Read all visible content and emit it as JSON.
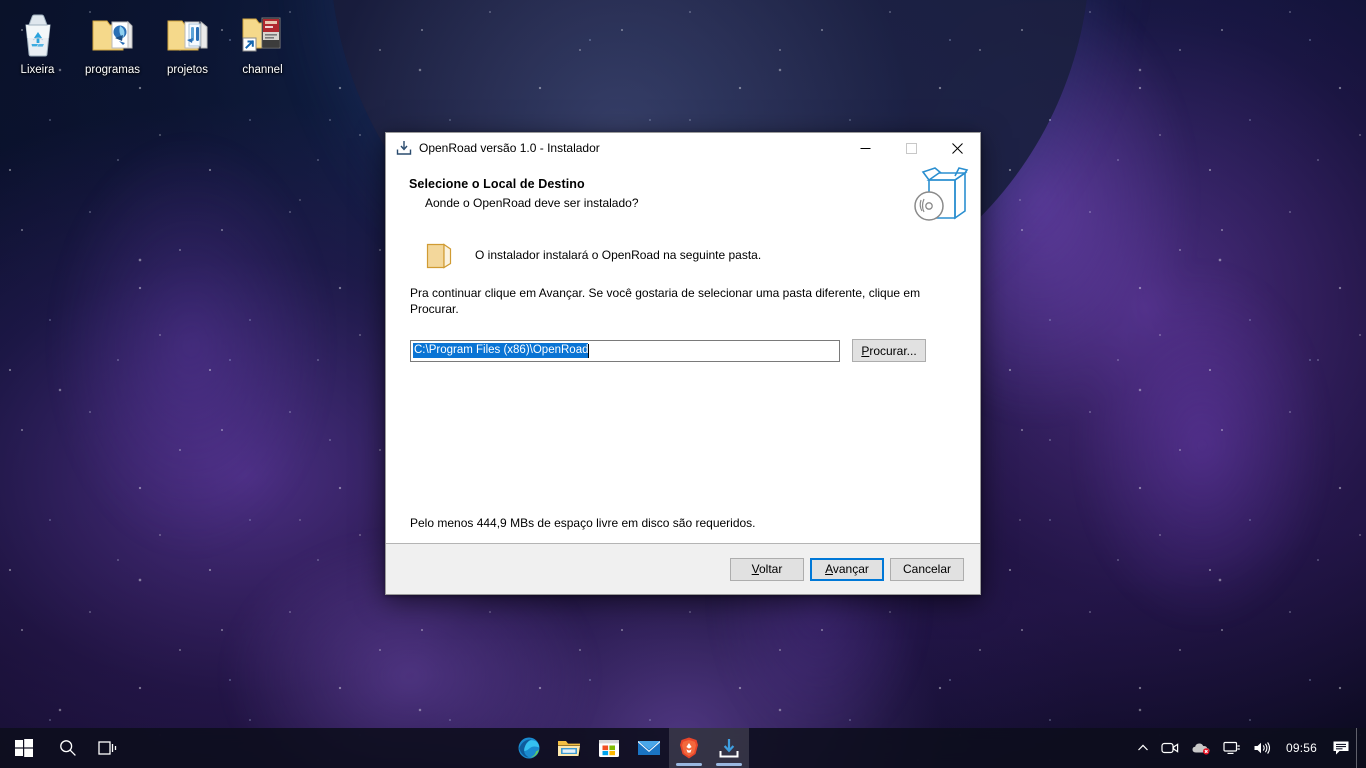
{
  "desktop": {
    "icons": [
      {
        "name": "recycle-bin",
        "label": "Lixeira",
        "type": "recycle-bin"
      },
      {
        "name": "programas",
        "label": "programas",
        "type": "folder-media"
      },
      {
        "name": "projetos",
        "label": "projetos",
        "type": "folder-files"
      },
      {
        "name": "channel",
        "label": "channel",
        "type": "folder-shortcut"
      }
    ]
  },
  "installer": {
    "titlebar": {
      "title": "OpenRoad versão 1.0 - Instalador",
      "icon": "installer-download-icon",
      "minimize_label": "Minimizar",
      "maximize_label": "Maximizar",
      "close_label": "Fechar"
    },
    "header": {
      "title": "Selecione o Local de Destino",
      "subtitle": "Aonde o OpenRoad deve ser instalado?",
      "graphic": "setup-box-disc-icon"
    },
    "body": {
      "folder_icon": "folder-icon",
      "folder_line": "O instalador instalará o OpenRoad na seguinte pasta.",
      "instruction": "Pra continuar clique em Avançar. Se você gostaria de selecionar uma pasta diferente, clique em Procurar.",
      "path_value": "C:\\Program Files (x86)\\OpenRoad",
      "path_selected": true,
      "browse_label": "Procurar...",
      "space_note": "Pelo menos 444,9 MBs de espaço livre em disco são requeridos."
    },
    "footer": {
      "back_label": "Voltar",
      "next_label": "Avançar",
      "cancel_label": "Cancelar",
      "default_button": "next"
    },
    "colors": {
      "selection_blue": "#0a74d4",
      "focus_border": "#0078d7",
      "dialog_face": "#f0f0f0",
      "body_white": "#ffffff"
    }
  },
  "taskbar": {
    "start_label": "Iniciar",
    "search_label": "Pesquisar",
    "taskview_label": "Visão de tarefas",
    "apps": [
      {
        "name": "microsoft-edge",
        "label": "Microsoft Edge",
        "active": false
      },
      {
        "name": "file-explorer",
        "label": "Explorador de Arquivos",
        "active": false
      },
      {
        "name": "microsoft-store",
        "label": "Microsoft Store",
        "active": false
      },
      {
        "name": "mail",
        "label": "Email",
        "active": false
      },
      {
        "name": "brave-browser",
        "label": "Brave",
        "active": true
      },
      {
        "name": "openroad-installer",
        "label": "OpenRoad versão 1.0 - Instalador",
        "active": true
      }
    ],
    "tray": {
      "overflow_label": "Mostrar ícones ocultos",
      "meet_now_label": "Reunir-se agora",
      "onedrive_label": "OneDrive",
      "network_label": "Rede",
      "volume_label": "Volume",
      "clock": "09:56",
      "action_center_label": "Central de ações"
    }
  }
}
